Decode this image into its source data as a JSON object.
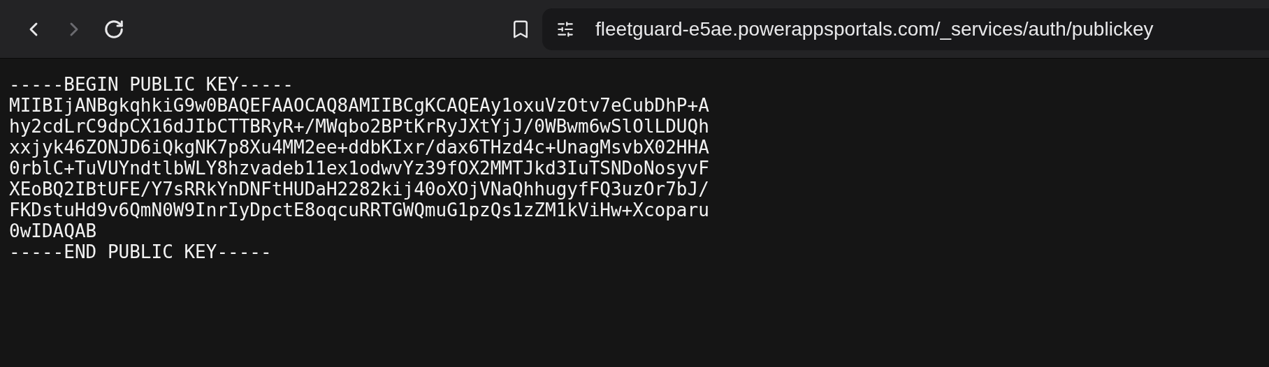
{
  "toolbar": {
    "back": {
      "disabled": false
    },
    "forward": {
      "disabled": true
    },
    "address": "fleetguard-e5ae.powerappsportals.com/_services/auth/publickey"
  },
  "document": {
    "lines": [
      "-----BEGIN PUBLIC KEY-----",
      "MIIBIjANBgkqhkiG9w0BAQEFAAOCAQ8AMIIBCgKCAQEAy1oxuVzOtv7eCubDhP+A",
      "hy2cdLrC9dpCX16dJIbCTTBRyR+/MWqbo2BPtKrRyJXtYjJ/0WBwm6wSlOlLDUQh",
      "xxjyk46ZONJD6iQkgNK7p8Xu4MM2ee+ddbKIxr/dax6THzd4c+UnagMsvbX02HHA",
      "0rblC+TuVUYndtlbWLY8hzvadeb11ex1odwvYz39fOX2MMTJkd3IuTSNDoNosyvF",
      "XEoBQ2IBtUFE/Y7sRRkYnDNFtHUDaH2282kij40oXOjVNaQhhugyfFQ3uzOr7bJ/",
      "FKDstuHd9v6QmN0W9InrIyDpctE8oqcuRRTGWQmuG1pzQs1zZM1kViHw+Xcoparu",
      "0wIDAQAB",
      "-----END PUBLIC KEY-----"
    ]
  }
}
